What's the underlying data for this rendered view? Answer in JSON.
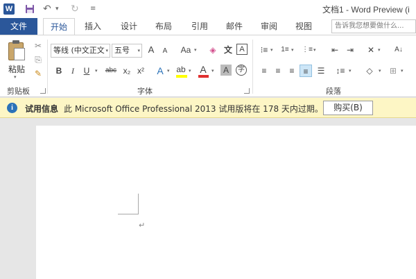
{
  "titlebar": {
    "app_icon": "W",
    "title": "文档1 - Word Preview (i",
    "qat": {
      "save": "save-icon",
      "undo": "undo-icon",
      "redo": "redo-icon",
      "customize": "customize-qat-icon"
    }
  },
  "tabs": {
    "file": "文件",
    "items": [
      "开始",
      "插入",
      "设计",
      "布局",
      "引用",
      "邮件",
      "审阅",
      "视图"
    ],
    "active": "开始",
    "tell_me_placeholder": "告诉我您想要做什么..."
  },
  "ribbon": {
    "clipboard": {
      "label": "剪贴板",
      "paste": "粘贴"
    },
    "font": {
      "label": "字体",
      "font_name": "等线 (中文正文",
      "font_size": "五号",
      "buttons": [
        "A",
        "A",
        "Aa",
        "B",
        "I",
        "U",
        "abc",
        "x₂",
        "x²"
      ]
    },
    "paragraph": {
      "label": "段落"
    }
  },
  "infobar": {
    "title": "试用信息",
    "message": "此 Microsoft Office Professional 2013 试用版将在 178 天内过期。",
    "button": "购买(B)"
  },
  "document": {
    "para_mark": "↵"
  },
  "colors": {
    "accent": "#2b579a",
    "infobar_bg": "#fdf6c5"
  }
}
